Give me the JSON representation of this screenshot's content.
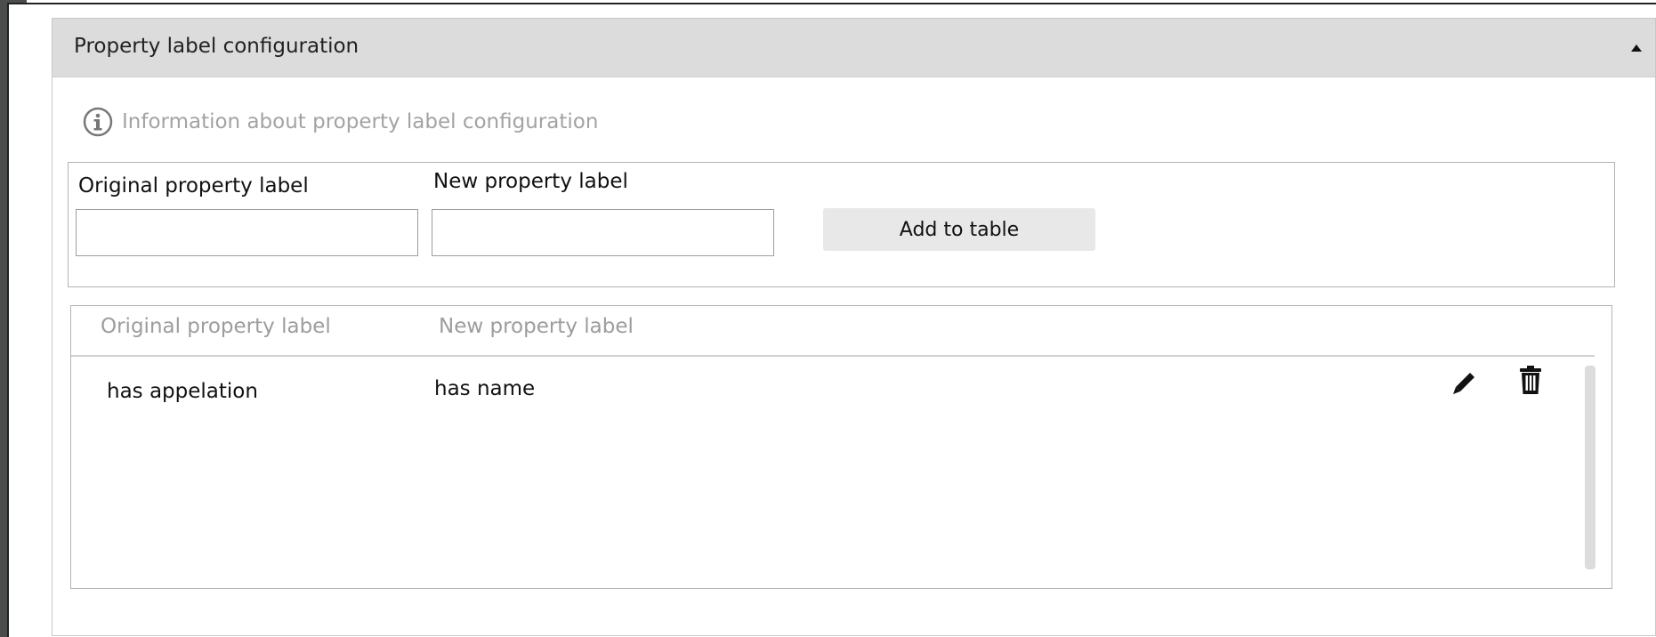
{
  "panel": {
    "title": "Property label configuration",
    "info_text": "Information about property label configuration"
  },
  "form": {
    "original_label": "Original property label",
    "new_label": "New property label",
    "original_value": "",
    "new_value": "",
    "add_button_label": "Add to table"
  },
  "table": {
    "columns": [
      "Original property label",
      "New property label"
    ],
    "rows": [
      {
        "original": "has appelation",
        "new": "has name"
      }
    ]
  },
  "icons": {
    "collapse": "caret-up-icon",
    "info": "info-circle-icon",
    "edit": "pencil-icon",
    "delete": "trash-icon"
  },
  "colors": {
    "header_bg": "#dcdcdc",
    "muted_text": "#a3a3a3",
    "button_bg": "#e8e8e8"
  }
}
